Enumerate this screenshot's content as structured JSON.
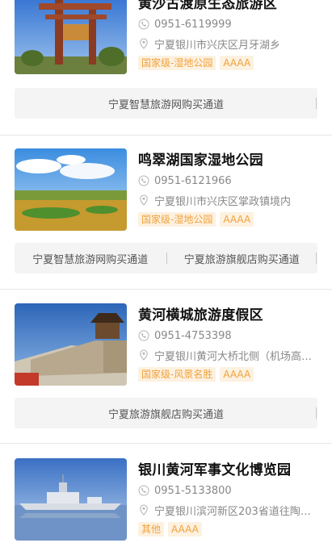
{
  "scenics": [
    {
      "name": "黄沙古渡原生态旅游区",
      "phone": "0951-6119999",
      "address": "宁夏银川市兴庆区月牙湖乡",
      "tags": [
        "国家级-湿地公园",
        "AAAA"
      ],
      "channels": [
        "宁夏智慧旅游网购买通道"
      ],
      "image_icon": "park-gate-image"
    },
    {
      "name": "鸣翠湖国家湿地公园",
      "phone": "0951-6121966",
      "address": "宁夏银川市兴庆区掌政镇境内",
      "tags": [
        "国家级-湿地公园",
        "AAAA"
      ],
      "channels": [
        "宁夏智慧旅游网购买通道",
        "宁夏旅游旗舰店购买通道"
      ],
      "image_icon": "wetland-image"
    },
    {
      "name": "黄河横城旅游度假区",
      "phone": "0951-4753398",
      "address": "宁夏银川黄河大桥北侧（机场高…",
      "tags": [
        "国家级-风景名胜",
        "AAAA"
      ],
      "channels": [
        "宁夏旅游旗舰店购买通道"
      ],
      "image_icon": "city-wall-image"
    },
    {
      "name": "银川黄河军事文化博览园",
      "phone": "0951-5133800",
      "address": "宁夏银川滨河新区203省道往陶…",
      "tags": [
        "其他",
        "AAAA"
      ],
      "channels": [],
      "image_icon": "warship-image"
    }
  ],
  "colors": {
    "tag_text": "#f0a23c",
    "tag_bg": "#fdf1e0",
    "channel_bg": "#f4f4f4"
  }
}
